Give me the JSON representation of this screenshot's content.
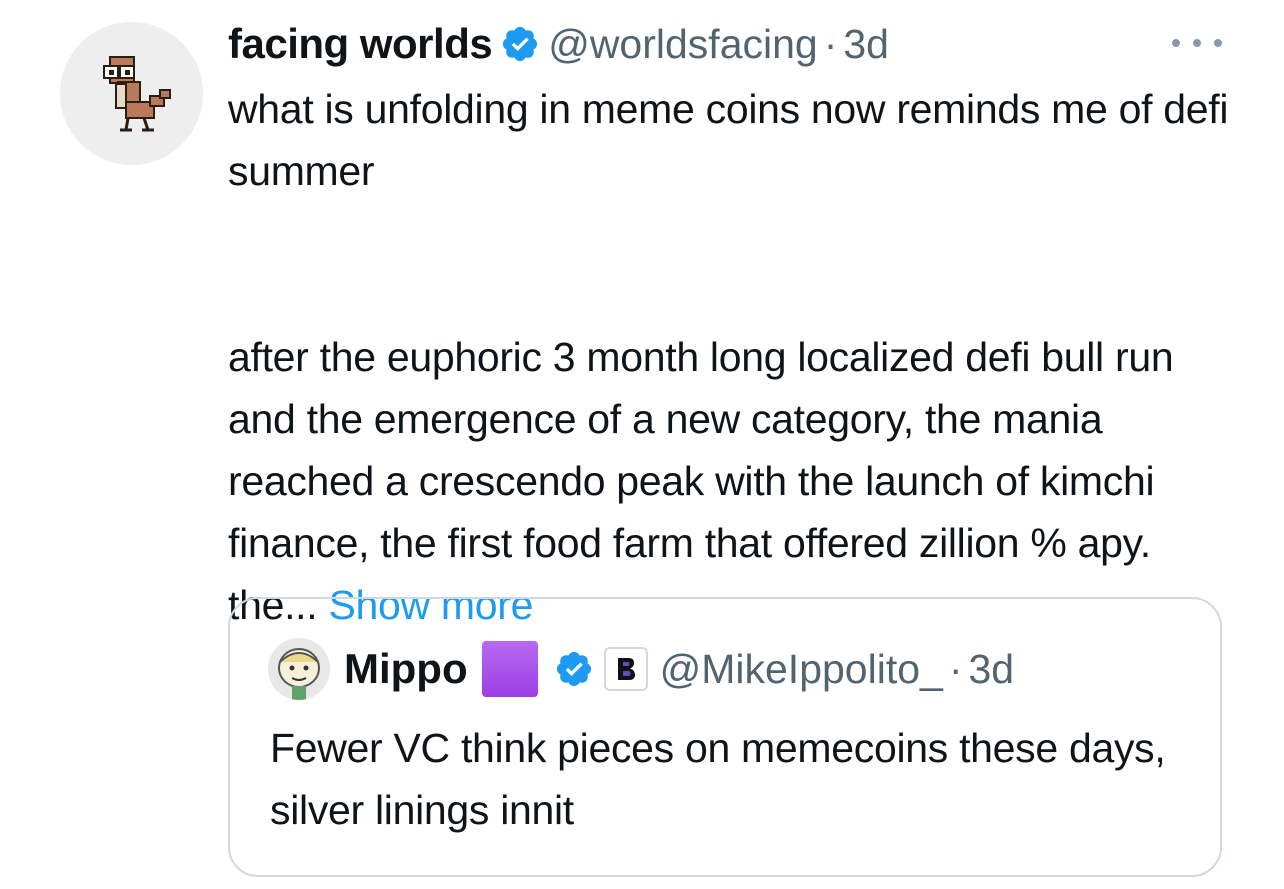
{
  "tweet": {
    "author": {
      "display_name": "facing worlds",
      "handle": "@worldsfacing",
      "avatar_icon": "pixel-creature-avatar",
      "verified": true
    },
    "separator": "·",
    "time": "3d",
    "more_icon": "more-horizontal-icon",
    "text_para1": "what is unfolding in meme coins now reminds me of defi summer",
    "text_para2": "after the euphoric 3 month long localized defi bull run and the emergence of a new category, the mania reached a crescendo peak with the launch of kimchi finance, the first food farm that offered zillion % apy. the...",
    "show_more": "Show more"
  },
  "quote": {
    "author": {
      "display_name": "Mippo",
      "emoji": "purple-square",
      "handle": "@MikeIppolito_",
      "affiliate_badge": "B",
      "verified": true
    },
    "separator": "·",
    "time": "3d",
    "text": "Fewer VC think pieces on memecoins these days, silver linings innit"
  },
  "colors": {
    "link": "#1d9bf0",
    "secondary_text": "#536471",
    "border": "#cfd9de",
    "verified": "#1d9bf0"
  }
}
